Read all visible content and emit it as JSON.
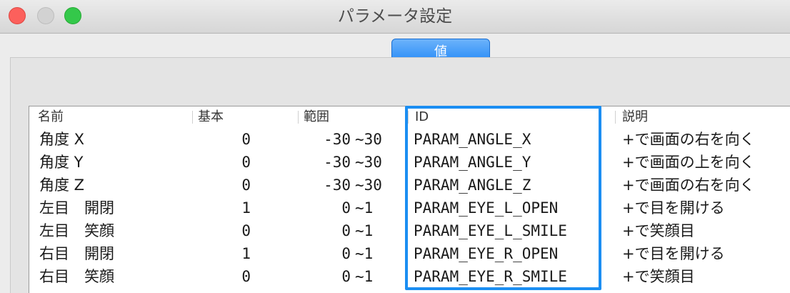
{
  "window": {
    "title": "パラメータ設定"
  },
  "tabs": {
    "active_label": "値"
  },
  "table": {
    "headers": {
      "name": "名前",
      "base": "基本",
      "range": "範囲",
      "id": "ID",
      "desc": "説明"
    },
    "rows": [
      {
        "name": "角度 X",
        "base": "0",
        "min": "-30",
        "max": "~30",
        "id": "PARAM_ANGLE_X",
        "desc": "+で画面の右を向く"
      },
      {
        "name": "角度 Y",
        "base": "0",
        "min": "-30",
        "max": "~30",
        "id": "PARAM_ANGLE_Y",
        "desc": "+で画面の上を向く"
      },
      {
        "name": "角度 Z",
        "base": "0",
        "min": "-30",
        "max": "~30",
        "id": "PARAM_ANGLE_Z",
        "desc": "+で画面の右を向く"
      },
      {
        "name": "左目　開閉",
        "base": "1",
        "min": "0",
        "max": "~1",
        "id": "PARAM_EYE_L_OPEN",
        "desc": "+で目を開ける"
      },
      {
        "name": "左目　笑顔",
        "base": "0",
        "min": "0",
        "max": "~1",
        "id": "PARAM_EYE_L_SMILE",
        "desc": "+で笑顔目"
      },
      {
        "name": "右目　開閉",
        "base": "1",
        "min": "0",
        "max": "~1",
        "id": "PARAM_EYE_R_OPEN",
        "desc": "+で目を開ける"
      },
      {
        "name": "右目　笑顔",
        "base": "0",
        "min": "0",
        "max": "~1",
        "id": "PARAM_EYE_R_SMILE",
        "desc": "+で笑顔目"
      }
    ]
  },
  "colors": {
    "highlight": "#1b8ef2",
    "tab_button": "#1f85f7"
  }
}
